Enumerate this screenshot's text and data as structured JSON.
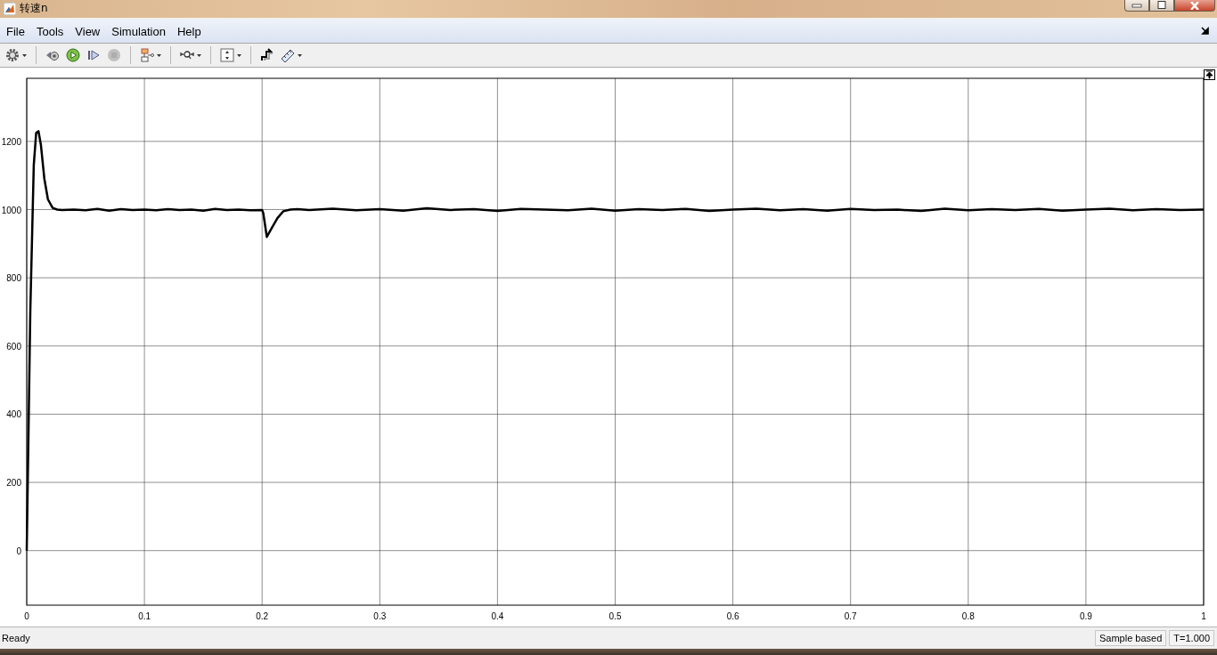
{
  "window": {
    "title": "转速n"
  },
  "menu": [
    {
      "label": "File"
    },
    {
      "label": "Tools"
    },
    {
      "label": "View"
    },
    {
      "label": "Simulation"
    },
    {
      "label": "Help"
    }
  ],
  "toolbar": [
    {
      "kind": "settings",
      "dropdown": true,
      "disabled": false,
      "group_end": true
    },
    {
      "kind": "step-back",
      "dropdown": false,
      "disabled": false,
      "group_end": false
    },
    {
      "kind": "run",
      "dropdown": false,
      "disabled": false,
      "group_end": false
    },
    {
      "kind": "step-forward",
      "dropdown": false,
      "disabled": false,
      "group_end": false
    },
    {
      "kind": "stop",
      "dropdown": false,
      "disabled": true,
      "group_end": true
    },
    {
      "kind": "signal-select",
      "dropdown": true,
      "disabled": false,
      "group_end": true
    },
    {
      "kind": "zoom",
      "dropdown": true,
      "disabled": false,
      "group_end": true
    },
    {
      "kind": "autoscale",
      "dropdown": true,
      "disabled": false,
      "group_end": true
    },
    {
      "kind": "style",
      "dropdown": false,
      "disabled": false,
      "group_end": false
    },
    {
      "kind": "measure",
      "dropdown": true,
      "disabled": false,
      "group_end": false
    }
  ],
  "scope": {
    "chart_data": {
      "type": "line",
      "grid": true,
      "xlim": [
        0,
        1
      ],
      "ylim": [
        -160,
        1385
      ],
      "xticks": [
        0,
        {
          "value": 0.1,
          "label": "0.1"
        },
        {
          "value": 0.2,
          "label": "0.2"
        },
        {
          "value": 0.3,
          "label": "0.3"
        },
        {
          "value": 0.4,
          "label": "0.4"
        },
        {
          "value": 0.5,
          "label": "0.5"
        },
        {
          "value": 0.6,
          "label": "0.6"
        },
        {
          "value": 0.7,
          "label": "0.7"
        },
        {
          "value": 0.8,
          "label": "0.8"
        },
        {
          "value": 0.9,
          "label": "0.9"
        },
        1
      ],
      "yticks": [
        0,
        200,
        400,
        600,
        800,
        1000,
        1200
      ],
      "x": [
        0,
        0.003,
        0.006,
        0.008,
        0.01,
        0.012,
        0.015,
        0.018,
        0.022,
        0.026,
        0.03,
        0.04,
        0.05,
        0.06,
        0.07,
        0.08,
        0.09,
        0.1,
        0.11,
        0.12,
        0.13,
        0.14,
        0.15,
        0.16,
        0.17,
        0.18,
        0.19,
        0.2,
        0.201,
        0.204,
        0.208,
        0.213,
        0.218,
        0.224,
        0.23,
        0.24,
        0.26,
        0.28,
        0.3,
        0.32,
        0.34,
        0.36,
        0.38,
        0.4,
        0.42,
        0.44,
        0.46,
        0.48,
        0.5,
        0.52,
        0.54,
        0.56,
        0.58,
        0.6,
        0.62,
        0.64,
        0.66,
        0.68,
        0.7,
        0.72,
        0.74,
        0.76,
        0.78,
        0.8,
        0.82,
        0.84,
        0.86,
        0.88,
        0.9,
        0.92,
        0.94,
        0.96,
        0.98,
        1
      ],
      "series": [
        {
          "color": "#000000",
          "values": [
            0,
            700,
            1130,
            1225,
            1230,
            1190,
            1090,
            1030,
            1005,
            1000,
            999,
            1000,
            998,
            1002,
            997,
            1001,
            999,
            1000,
            998,
            1001,
            999,
            1000,
            997,
            1002,
            999,
            1000,
            998,
            999,
            990,
            920,
            945,
            975,
            995,
            1000,
            1001,
            999,
            1003,
            998,
            1001,
            997,
            1004,
            999,
            1001,
            996,
            1002,
            1000,
            998,
            1003,
            997,
            1001,
            999,
            1002,
            996,
            1000,
            1003,
            998,
            1001,
            997,
            1002,
            999,
            1000,
            996,
            1003,
            998,
            1001,
            999,
            1002,
            997,
            1000,
            1003,
            998,
            1001,
            999,
            1000
          ]
        }
      ]
    }
  },
  "status_bar": {
    "message": "Ready",
    "fields": [
      "Sample based",
      "T=1.000"
    ]
  }
}
